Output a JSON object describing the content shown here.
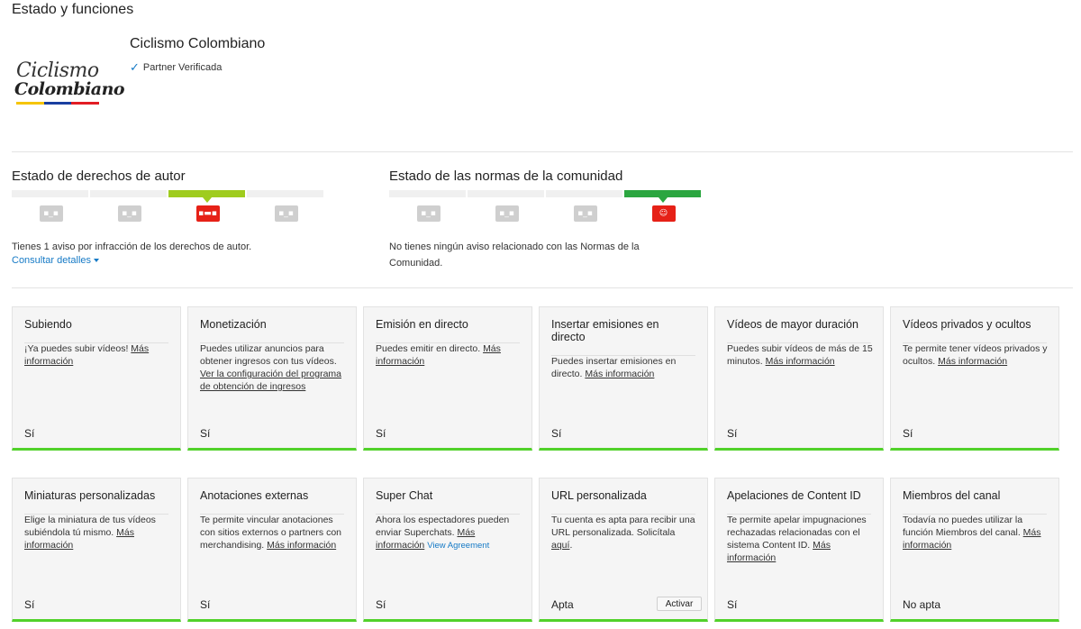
{
  "page": {
    "title": "Estado y funciones"
  },
  "channel": {
    "logo_line1": "Ciclismo",
    "logo_line2": "Colombiano",
    "logo_stripe_colors": [
      "#f5c400",
      "#1a3fa0",
      "#e21d24"
    ],
    "name": "Ciclismo Colombiano",
    "badge": "Partner Verificada",
    "badge_icon": "check-icon"
  },
  "copyright": {
    "title": "Estado de derechos de autor",
    "active_index": 2,
    "active_color": "#9fcc1e",
    "segments": 4,
    "description": "Tienes 1 aviso por infracción de los derechos de autor.",
    "details_link": "Consultar detalles"
  },
  "community": {
    "title": "Estado de las normas de la comunidad",
    "active_index": 3,
    "active_color": "#2ba640",
    "segments": 4,
    "description_line1": "No tienes ningún aviso relacionado con las Normas de la",
    "description_line2": "Comunidad."
  },
  "colors": {
    "card_bar": "#51d12a",
    "face_active": "#e62117",
    "face_inactive": "#cfcfcf",
    "link": "#167ac6"
  },
  "features_row1": [
    {
      "title": "Subiendo",
      "body": "¡Ya puedes subir vídeos! ",
      "link": "Más información",
      "status": "Sí"
    },
    {
      "title": "Monetización",
      "body": "Puedes utilizar anuncios para obtener ingresos con tus vídeos. ",
      "link": "Ver la configuración del programa de obtención de ingresos",
      "status": "Sí"
    },
    {
      "title": "Emisión en directo",
      "body": "Puedes emitir en directo. ",
      "link": "Más información",
      "status": "Sí"
    },
    {
      "title": "Insertar emisiones en directo",
      "body": "Puedes insertar emisiones en directo. ",
      "link": "Más información",
      "status": "Sí"
    },
    {
      "title": "Vídeos de mayor duración",
      "body": "Puedes subir vídeos de más de 15 minutos. ",
      "link": "Más información",
      "status": "Sí"
    },
    {
      "title": "Vídeos privados y ocultos",
      "body": "Te permite tener vídeos privados y ocultos. ",
      "link": "Más información",
      "status": "Sí"
    }
  ],
  "features_row2": [
    {
      "title": "Miniaturas personalizadas",
      "body": "Elige la miniatura de tus vídeos subiéndola tú mismo. ",
      "link": "Más información",
      "status": "Sí"
    },
    {
      "title": "Anotaciones externas",
      "body": "Te permite vincular anotaciones con sitios externos o partners con merchandising. ",
      "link": "Más información",
      "status": "Sí"
    },
    {
      "title": "Super Chat",
      "body": "Ahora los espectadores pueden enviar Superchats. ",
      "link": "Más información",
      "extra_link": "View Agreement",
      "status": "Sí"
    },
    {
      "title": "URL personalizada",
      "body": "Tu cuenta es apta para recibir una URL personalizada. Solicítala ",
      "link": "aquí",
      "tail": ".",
      "status": "Apta",
      "button": "Activar"
    },
    {
      "title": "Apelaciones de Content ID",
      "body": "Te permite apelar impugnaciones rechazadas relacionadas con el sistema Content ID. ",
      "link": "Más información",
      "status": "Sí"
    },
    {
      "title": "Miembros del canal",
      "body": "Todavía no puedes utilizar la función Miembros del canal. ",
      "link": "Más información",
      "status": "No apta"
    }
  ]
}
